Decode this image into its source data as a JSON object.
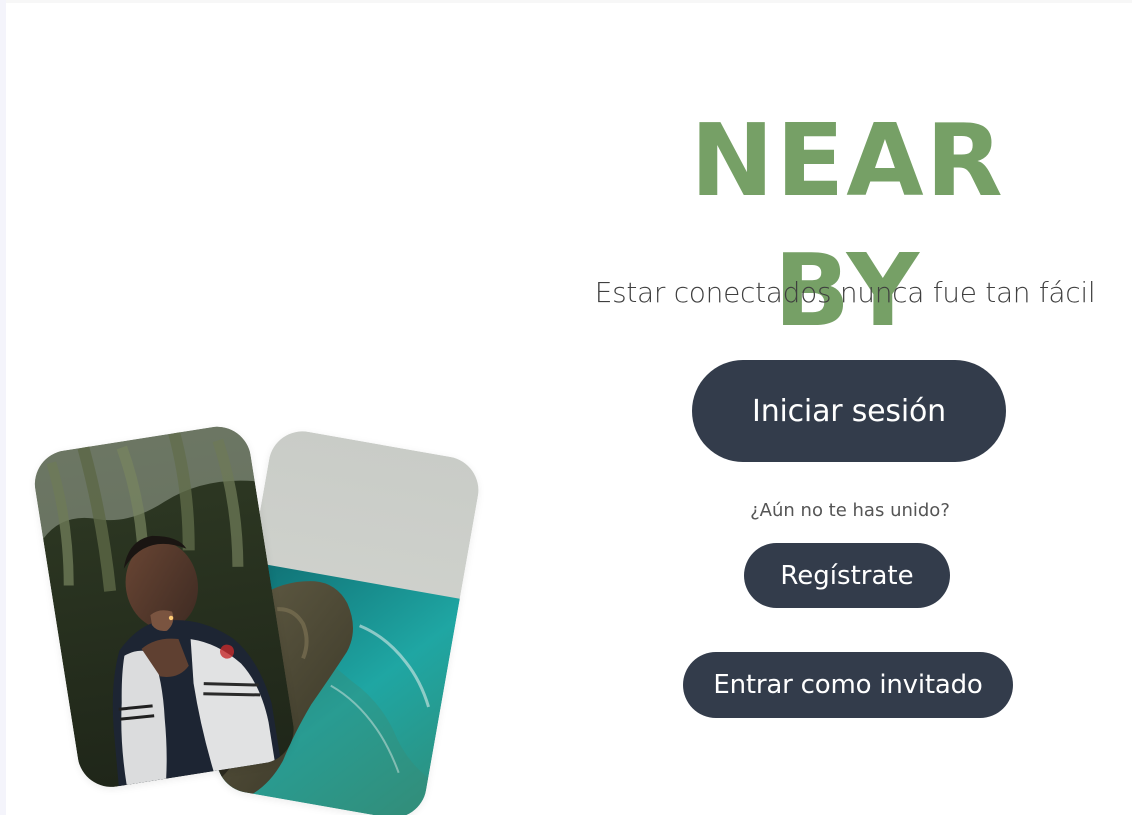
{
  "brand": {
    "title": "Near By",
    "color": "#76a066"
  },
  "tagline": "Estar conectados nunca fue tan fácil",
  "actions": {
    "login_label": "Iniciar sesión",
    "question": "¿Aún no te has unido?",
    "register_label": "Regístrate",
    "guest_label": "Entrar como invitado"
  },
  "theme": {
    "button_bg": "#333c4b",
    "button_text": "#ffffff",
    "page_bg": "#ffffff"
  },
  "images": {
    "front_card": "person-portrait-photo",
    "back_card": "coastal-cliff-photo"
  }
}
